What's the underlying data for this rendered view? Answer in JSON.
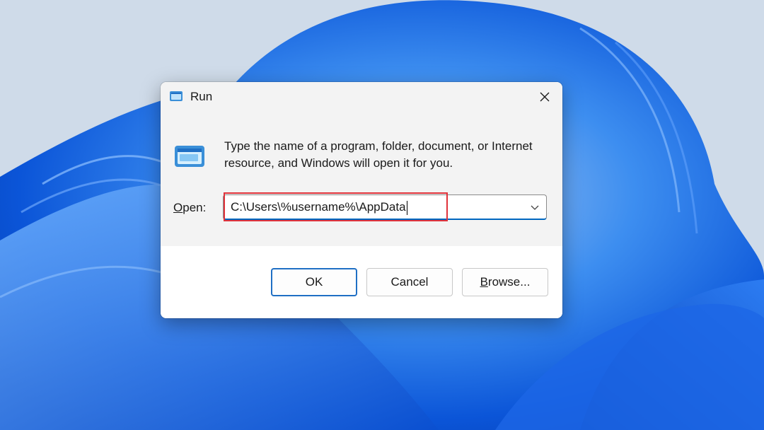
{
  "dialog": {
    "title": "Run",
    "description": "Type the name of a program, folder, document, or Internet resource, and Windows will open it for you.",
    "open_label_accel": "O",
    "open_label_rest": "pen:",
    "input_value": "C:\\Users\\%username%\\AppData",
    "buttons": {
      "ok": "OK",
      "cancel": "Cancel",
      "browse_accel": "B",
      "browse_rest": "rowse..."
    }
  },
  "colors": {
    "accent": "#0067c0",
    "highlight": "#e0323a",
    "wallpaper_blue": "#0a5fe0"
  },
  "icons": {
    "title": "run-app-icon",
    "body": "run-app-icon",
    "close": "close-icon",
    "dropdown": "chevron-down-icon"
  }
}
